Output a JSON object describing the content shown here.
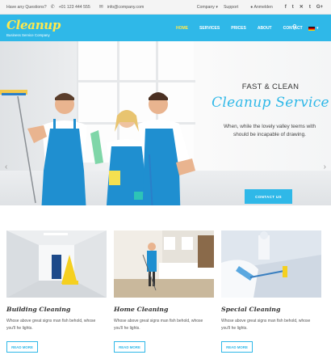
{
  "topbar": {
    "question": "Have any Questions?",
    "phone": "+01 123 444 555",
    "email": "info@company.com",
    "company_menu": "Company",
    "support": "Support",
    "login": "Anmelden",
    "social": [
      "f",
      "t",
      "✕",
      "t",
      "G+"
    ]
  },
  "nav": {
    "logo": "Cleanup",
    "tagline": "Business Service Company",
    "items": [
      {
        "label": "HOME",
        "active": true
      },
      {
        "label": "SERVICES",
        "active": false
      },
      {
        "label": "PRICES",
        "active": false
      },
      {
        "label": "ABOUT",
        "active": false
      },
      {
        "label": "CONTACT",
        "active": false
      }
    ]
  },
  "hero": {
    "subtitle": "FAST & CLEAN",
    "title": "Cleanup Service",
    "text": "When, while the lovely valley teems with vapour around me, and the meridian sun strikes the upper surface should be incapable of drawing.",
    "text_visible": "When, while the lovely valley teems with should be incapable of drawing.",
    "cta": "CONTACT US",
    "arrow_left": "‹",
    "arrow_right": "›"
  },
  "services": [
    {
      "title": "Building Cleaning",
      "desc": "Whose above great signs man fish behold, whose you'll he lights.",
      "button": "READ MORE"
    },
    {
      "title": "Home Cleaning",
      "desc": "Whose above great signs man fish behold, whose you'll he lights.",
      "button": "READ MORE"
    },
    {
      "title": "Special Cleaning",
      "desc": "Whose above great signs man fish behold, whose you'll he lights.",
      "button": "READ MORE"
    }
  ],
  "colors": {
    "accent": "#2fb8e8",
    "logo": "#ffe94d",
    "apron": "#1f8fd0"
  }
}
